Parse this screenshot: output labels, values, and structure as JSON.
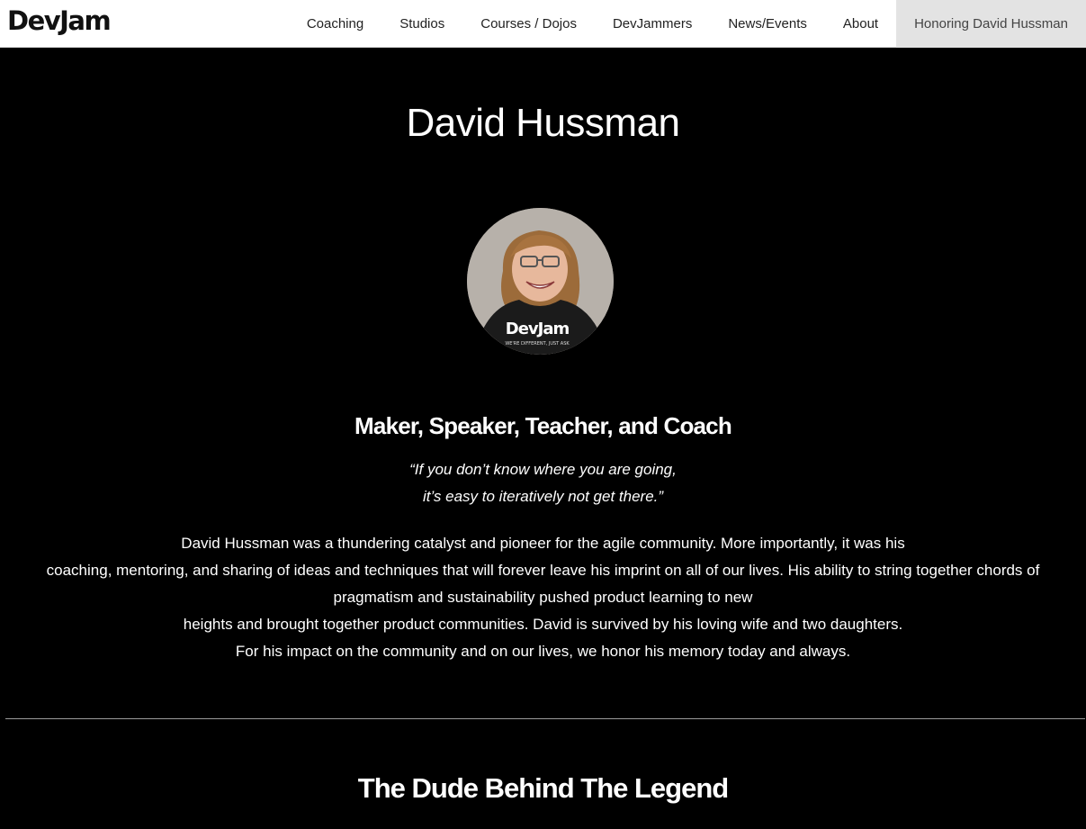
{
  "header": {
    "logo": "DevJam",
    "nav": [
      {
        "label": "Coaching"
      },
      {
        "label": "Studios"
      },
      {
        "label": "Courses / Dojos"
      },
      {
        "label": "DevJammers"
      },
      {
        "label": "News/Events"
      },
      {
        "label": "About"
      },
      {
        "label": "Honoring David Hussman"
      }
    ]
  },
  "main": {
    "title": "David Hussman",
    "photo": {
      "shirt_text": "DevJam",
      "shirt_tagline": "WE'RE DIFFERENT, JUST ASK"
    },
    "subtitle": "Maker, Speaker, Teacher, and Coach",
    "quote": {
      "line1": "“If you don’t know where you are going,",
      "line2": "it’s easy to iteratively not get there.”"
    },
    "bio": {
      "line1": "David Hussman was a thundering catalyst and pioneer for the agile community. More importantly, it was his",
      "line2": "coaching, mentoring, and sharing of ideas and techniques that will forever leave his imprint on all of our lives. His ability to string together chords of",
      "line3": "pragmatism and sustainability pushed product learning to new",
      "line4": "heights and brought together product communities. David is survived by his loving wife and two daughters.",
      "line5": "For his impact on the community and on our lives, we honor his memory today and always."
    },
    "section_title": "The Dude Behind The Legend"
  },
  "colors": {
    "background": "#000000",
    "navbar": "#ffffff",
    "active_nav": "#e3e3e3",
    "text": "#ffffff"
  }
}
